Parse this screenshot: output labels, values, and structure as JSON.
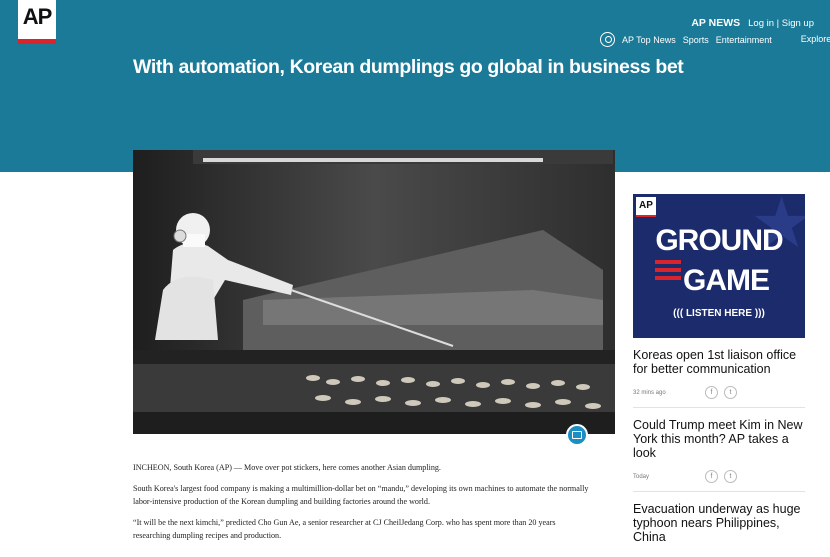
{
  "header": {
    "logo": "AP",
    "brand": "AP NEWS",
    "auth": "Log in | Sign up",
    "nav": [
      "AP Top News",
      "Sports",
      "Entertainment"
    ],
    "explore": "Explore",
    "explore_icon": "chevron-down-icon"
  },
  "article": {
    "title": "With automation, Korean dumplings go global in business bet",
    "paragraphs": [
      "INCHEON, South Korea (AP) — Move over pot stickers, here comes another Asian dumpling.",
      "South Korea's largest food company is making a multimillion-dollar bet on “mandu,” developing its own machines to automate the normally labor-intensive production of the Korean dumpling and building factories around the world.",
      "“It will be the next kimchi,” predicted Cho Gun Ae, a senior researcher at CJ CheilJedang Corp. who has spent more than 20 years researching dumpling recipes and production."
    ]
  },
  "ad": {
    "logo": "AP",
    "line1": "GROUND",
    "line2": "GAME",
    "cta": "((( LISTEN HERE )))"
  },
  "sidebar": {
    "stories": [
      {
        "title": "Koreas open 1st liaison office for better communication",
        "time": "32 mins ago"
      },
      {
        "title": "Could Trump meet Kim in New York this month? AP takes a look",
        "time": "Today"
      },
      {
        "title": "Evacuation underway as huge typhoon nears Philippines, China",
        "time": ""
      }
    ]
  },
  "colors": {
    "header": "#1b7a97",
    "accent": "#d9242b",
    "ad_bg": "#1c2b6b"
  }
}
